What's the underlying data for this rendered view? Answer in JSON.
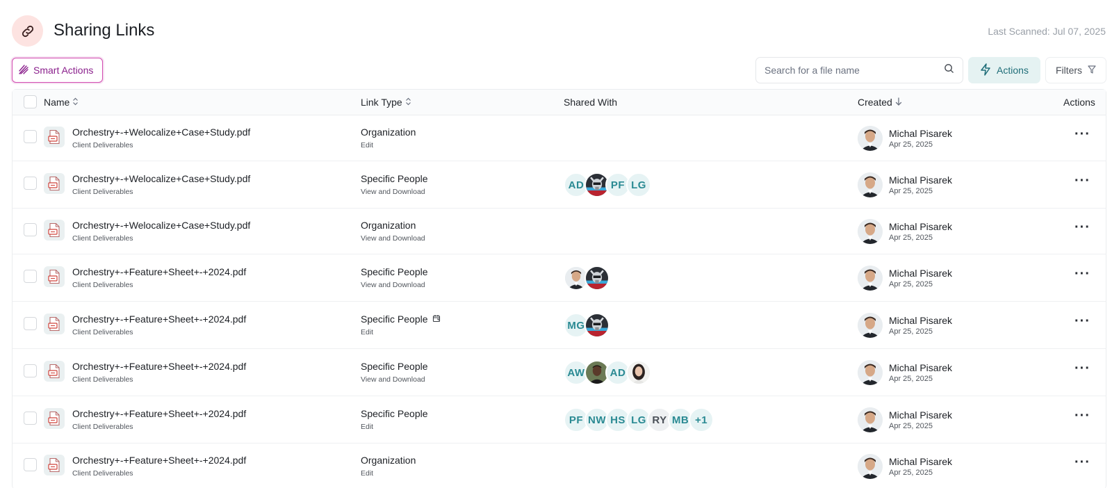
{
  "header": {
    "title": "Sharing Links",
    "last_scanned": "Last Scanned: Jul 07, 2025",
    "logo_icon": "link-icon"
  },
  "toolbar": {
    "smart_actions_label": "Smart Actions",
    "search_placeholder": "Search for a file name",
    "actions_label": "Actions",
    "filters_label": "Filters"
  },
  "table": {
    "columns": {
      "name": "Name",
      "link_type": "Link Type",
      "shared_with": "Shared With",
      "created": "Created",
      "actions": "Actions"
    },
    "rows": [
      {
        "file": "Orchestry+-+Welocalize+Case+Study.pdf",
        "folder": "Client Deliverables",
        "link_type": "Organization",
        "permission": "Edit",
        "shared": [],
        "creator": "Michal Pisarek",
        "date": "Apr 25, 2025"
      },
      {
        "file": "Orchestry+-+Welocalize+Case+Study.pdf",
        "folder": "Client Deliverables",
        "link_type": "Specific People",
        "permission": "View and Download",
        "shared": [
          {
            "text": "AD"
          },
          {
            "photo": "robot"
          },
          {
            "text": "PF"
          },
          {
            "text": "LG"
          }
        ],
        "creator": "Michal Pisarek",
        "date": "Apr 25, 2025"
      },
      {
        "file": "Orchestry+-+Welocalize+Case+Study.pdf",
        "folder": "Client Deliverables",
        "link_type": "Organization",
        "permission": "View and Download",
        "shared": [],
        "creator": "Michal Pisarek",
        "date": "Apr 25, 2025"
      },
      {
        "file": "Orchestry+-+Feature+Sheet+-+2024.pdf",
        "folder": "Client Deliverables",
        "link_type": "Specific People",
        "permission": "View and Download",
        "shared": [
          {
            "photo": "man"
          },
          {
            "photo": "robot"
          }
        ],
        "creator": "Michal Pisarek",
        "date": "Apr 25, 2025"
      },
      {
        "file": "Orchestry+-+Feature+Sheet+-+2024.pdf",
        "folder": "Client Deliverables",
        "link_type": "Specific People",
        "permission": "Edit",
        "calendar": true,
        "shared": [
          {
            "text": "MG"
          },
          {
            "photo": "robot"
          }
        ],
        "creator": "Michal Pisarek",
        "date": "Apr 25, 2025"
      },
      {
        "file": "Orchestry+-+Feature+Sheet+-+2024.pdf",
        "folder": "Client Deliverables",
        "link_type": "Specific People",
        "permission": "View and Download",
        "shared": [
          {
            "text": "AW"
          },
          {
            "photo": "man2"
          },
          {
            "text": "AD"
          },
          {
            "photo": "woman"
          }
        ],
        "creator": "Michal Pisarek",
        "date": "Apr 25, 2025"
      },
      {
        "file": "Orchestry+-+Feature+Sheet+-+2024.pdf",
        "folder": "Client Deliverables",
        "link_type": "Specific People",
        "permission": "Edit",
        "shared": [
          {
            "text": "PF"
          },
          {
            "text": "NW"
          },
          {
            "text": "HS"
          },
          {
            "text": "LG"
          },
          {
            "text": "RY",
            "gray": true
          },
          {
            "text": "MB"
          },
          {
            "text": "+1"
          }
        ],
        "creator": "Michal Pisarek",
        "date": "Apr 25, 2025"
      },
      {
        "file": "Orchestry+-+Feature+Sheet+-+2024.pdf",
        "folder": "Client Deliverables",
        "link_type": "Organization",
        "permission": "Edit",
        "shared": [],
        "creator": "Michal Pisarek",
        "date": "Apr 25, 2025"
      }
    ]
  },
  "colors": {
    "accent_teal": "#2a8a93",
    "smart_purple": "#8a1f8c",
    "logo_bg": "#fde3e1"
  }
}
